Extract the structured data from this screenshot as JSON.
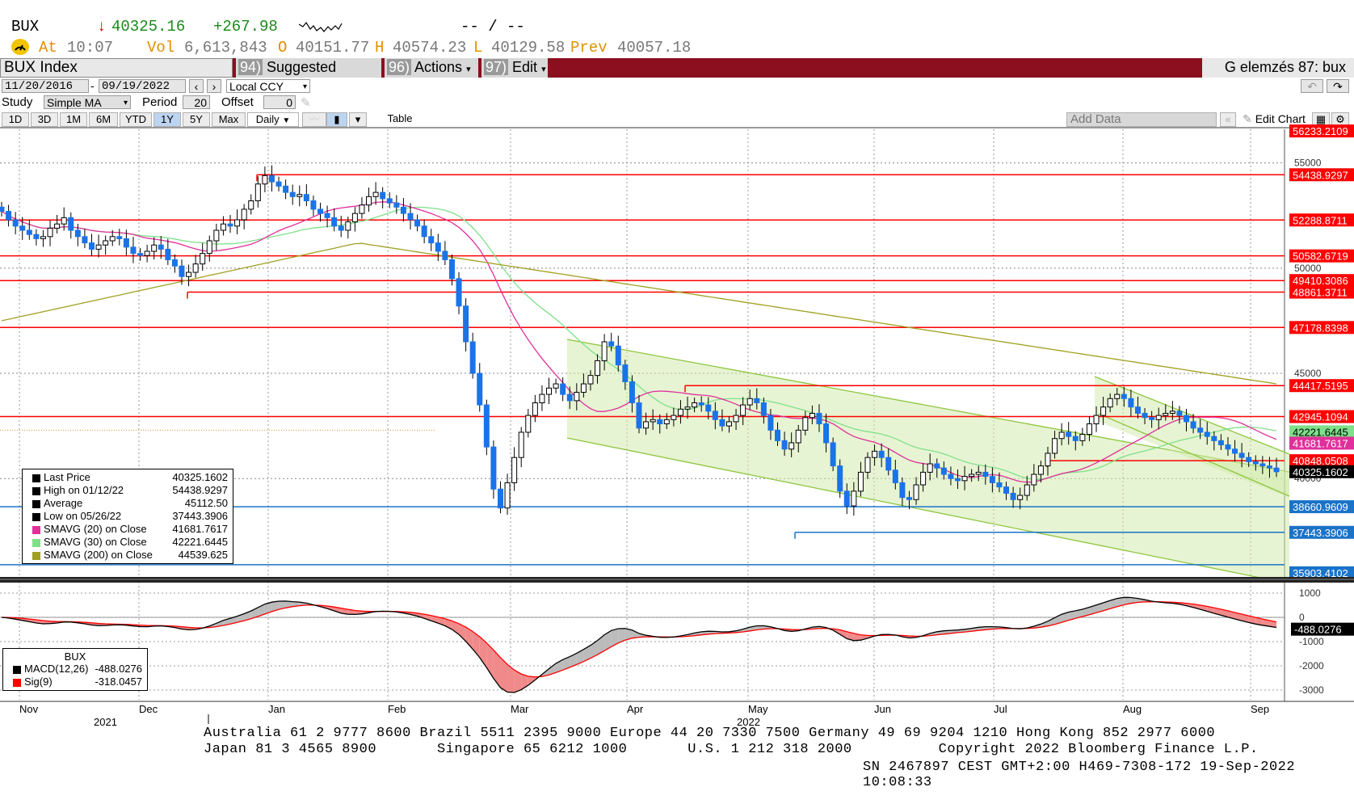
{
  "header": {
    "ticker": "BUX",
    "arrow": "↓",
    "last": "40325.16",
    "change": "+267.98",
    "range_placeholder": "-- / --",
    "at_label": "At",
    "time": "10:07",
    "vol_label": "Vol",
    "vol": "6,613,843",
    "open_label": "O",
    "open": "40151.77",
    "high_label": "H",
    "high": "40574.23",
    "low_label": "L",
    "low": "40129.58",
    "prev_label": "Prev",
    "prev": "40057.18"
  },
  "menubar": {
    "security": "BUX Index",
    "suggested_num": "94)",
    "suggested": "Suggested Charts",
    "actions_num": "96)",
    "actions": "Actions",
    "edit_num": "97)",
    "edit": "Edit",
    "right_title": "G elemzés 87: bux"
  },
  "controls": {
    "start_date": "11/20/2016",
    "end_date": "09/19/2022",
    "currency": "Local CCY",
    "study_label": "Study",
    "study": "Simple MA",
    "period_label": "Period",
    "period": "20",
    "offset_label": "Offset",
    "offset": "0",
    "ranges": [
      "1D",
      "3D",
      "1M",
      "6M",
      "YTD",
      "1Y",
      "5Y",
      "Max"
    ],
    "active_range": "1Y",
    "frequency": "Daily",
    "table": "Table",
    "add_data": "Add Data",
    "edit_chart": "Edit Chart"
  },
  "price_legend": {
    "rows": [
      {
        "label": "Last Price",
        "value": "40325.1602",
        "color": "#000000"
      },
      {
        "label": "High on 01/12/22",
        "value": "54438.9297",
        "color": "#000000"
      },
      {
        "label": "Average",
        "value": "45112.50",
        "color": "#000000"
      },
      {
        "label": "Low on 05/26/22",
        "value": "37443.3906",
        "color": "#000000"
      },
      {
        "label": "SMAVG (20)  on Close",
        "value": "41681.7617",
        "color": "#e0309a"
      },
      {
        "label": "SMAVG (30)  on Close",
        "value": "42221.6445",
        "color": "#7fe08a"
      },
      {
        "label": "SMAVG (200)  on Close",
        "value": "44539.625",
        "color": "#a0a020"
      }
    ]
  },
  "macd_legend": {
    "title": "BUX",
    "rows": [
      {
        "label": "MACD(12,26)",
        "value": "-488.0276",
        "color": "#000000"
      },
      {
        "label": "Sig(9)",
        "value": "-318.0457",
        "color": "#ff0000"
      }
    ]
  },
  "footer": {
    "line1": "Australia 61 2 9777 8600 Brazil 5511 2395 9000 Europe 44 20 7330 7500 Germany 49 69 9204 1210 Hong Kong 852 2977 6000",
    "line2": "Japan 81 3 4565 8900       Singapore 65 6212 1000       U.S. 1 212 318 2000          Copyright 2022 Bloomberg Finance L.P.",
    "line3": "SN 2467897 CEST GMT+2:00 H469-7308-172 19-Sep-2022 10:08:33"
  },
  "chart_data": {
    "type": "candlestick",
    "title": "BUX Index",
    "x_months": [
      "Nov",
      "Dec",
      "Jan",
      "Feb",
      "Mar",
      "Apr",
      "May",
      "Jun",
      "Jul",
      "Aug",
      "Sep"
    ],
    "x_years": [
      "2021",
      "2022"
    ],
    "y_ticks": [
      40000,
      45000,
      50000,
      55000
    ],
    "ylim": [
      35400,
      56600
    ],
    "horizontal_levels": [
      {
        "value": 54438.9297,
        "label": "54438.9297",
        "color": "#ff0000"
      },
      {
        "value": 52288.8711,
        "label": "52288.8711",
        "color": "#ff0000"
      },
      {
        "value": 50582.6719,
        "label": "50582.6719",
        "color": "#ff0000"
      },
      {
        "value": 49410.3086,
        "label": "49410.3086",
        "color": "#ff0000"
      },
      {
        "value": 48861.3711,
        "label": "48861.3711",
        "color": "#ff0000"
      },
      {
        "value": 47178.8398,
        "label": "47178.8398",
        "color": "#ff0000"
      },
      {
        "value": 44417.5195,
        "label": "44417.5195",
        "color": "#ff0000"
      },
      {
        "value": 42945.1094,
        "label": "42945.1094",
        "color": "#ff0000"
      },
      {
        "value": 40848.0508,
        "label": "40848.0508",
        "color": "#ff0000"
      },
      {
        "value": 38660.9609,
        "label": "38660.9609",
        "color": "#1a73c8"
      },
      {
        "value": 37443.3906,
        "label": "37443.3906",
        "color": "#1a73c8"
      },
      {
        "value": 35903.4102,
        "label": "35903.4102",
        "color": "#1a73c8"
      },
      {
        "value": 56233.2109,
        "label": "56233.2109",
        "color": "#ff0000"
      }
    ],
    "right_labels": [
      {
        "value": 42221.6445,
        "label": "42221.6445",
        "color": "#7fe08a"
      },
      {
        "value": 41681.7617,
        "label": "41681.7617",
        "color": "#e0309a"
      },
      {
        "value": 40325.1602,
        "label": "40325.1602",
        "color": "#000000"
      }
    ],
    "close_series": [
      52700,
      52300,
      52000,
      51800,
      51600,
      51400,
      51500,
      51900,
      52100,
      52400,
      51800,
      51500,
      51200,
      50900,
      51100,
      51300,
      51500,
      51400,
      51000,
      50700,
      50600,
      50800,
      51100,
      50900,
      50400,
      50100,
      49600,
      49800,
      50200,
      50700,
      51300,
      51800,
      52100,
      52000,
      52300,
      52800,
      53200,
      54000,
      54400,
      54100,
      53900,
      53600,
      53400,
      53500,
      53200,
      52800,
      52600,
      52400,
      52000,
      51800,
      52200,
      52600,
      53000,
      53400,
      53600,
      53300,
      53100,
      52900,
      52600,
      52300,
      52000,
      51500,
      51200,
      50800,
      50400,
      49500,
      48200,
      46500,
      45000,
      43500,
      41500,
      39500,
      38600,
      39800,
      41000,
      42200,
      43000,
      43600,
      44000,
      44300,
      44500,
      44000,
      43700,
      44100,
      44500,
      44900,
      45600,
      46500,
      46300,
      45400,
      44600,
      43600,
      42400,
      42700,
      42800,
      42600,
      42800,
      43000,
      43300,
      43400,
      43600,
      43500,
      43200,
      42800,
      42500,
      42700,
      43000,
      43500,
      43800,
      43600,
      43000,
      42300,
      41800,
      41400,
      41700,
      42300,
      42900,
      43100,
      42600,
      41700,
      40600,
      39400,
      38700,
      39400,
      40300,
      41000,
      41300,
      41000,
      40400,
      39800,
      39100,
      39000,
      39700,
      40300,
      40700,
      40500,
      40200,
      40000,
      39900,
      40100,
      40200,
      40300,
      40100,
      39800,
      39600,
      39300,
      39000,
      39200,
      39700,
      40200,
      40600,
      41200,
      41900,
      42200,
      42000,
      41800,
      42100,
      42600,
      43000,
      43400,
      43800,
      44000,
      43800,
      43400,
      43100,
      42900,
      42800,
      43000,
      43100,
      43200,
      43000,
      42700,
      42400,
      42200,
      42000,
      41800,
      41600,
      41400,
      41200,
      41000,
      40800,
      40700,
      40600,
      40500,
      40325
    ],
    "sma20_end": 41681.7617,
    "sma30_end": 42221.6445,
    "sma200_end": 44539.625,
    "macd": {
      "ylim": [
        -3400,
        1400
      ],
      "y_ticks": [
        1000,
        0,
        -1000,
        -2000,
        -3000
      ],
      "last_macd": -488.0276,
      "last_signal": -318.0457,
      "right_label": "-488.0276"
    }
  }
}
